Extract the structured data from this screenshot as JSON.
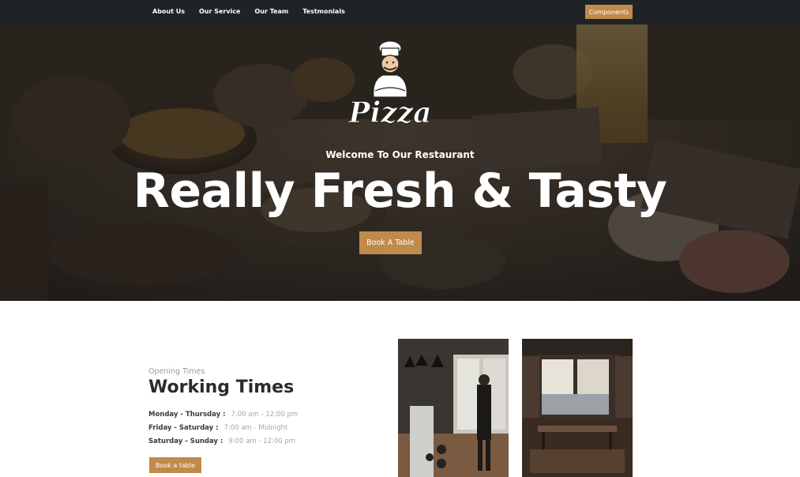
{
  "nav": {
    "links": [
      "About Us",
      "Our Service",
      "Our Team",
      "Testmonials"
    ],
    "button": "Components"
  },
  "hero": {
    "logo_text": "Pizza",
    "welcome": "Welcome To Our Restaurant",
    "headline": "Really Fresh & Tasty",
    "cta": "Book A Table"
  },
  "hours": {
    "eyebrow": "Opening Times",
    "title": "Working Times",
    "rows": [
      {
        "day": "Monday - Thursday :",
        "time": "7:00 am - 12:00 pm"
      },
      {
        "day": "Friday - Saturday :",
        "time": "7:00 am - Midnight"
      },
      {
        "day": "Saturday - Sunday :",
        "time": "9:00 am - 12:00 pm"
      }
    ],
    "cta": "Book a table"
  },
  "colors": {
    "accent": "#c08a4a",
    "nav_bg": "#1f2227",
    "title_text": "#2b2b2b",
    "muted_text": "#a6a6a6"
  }
}
